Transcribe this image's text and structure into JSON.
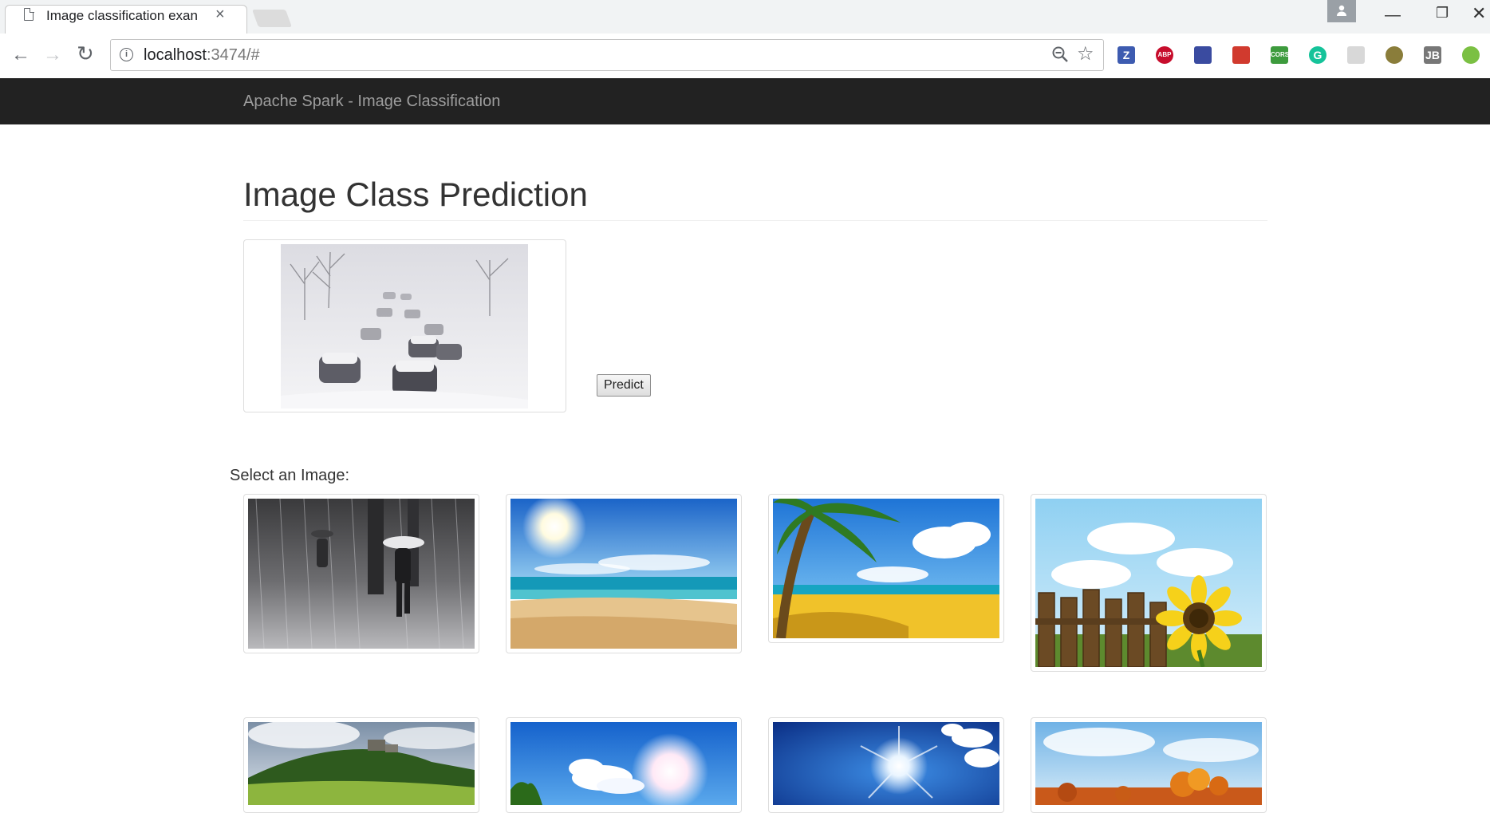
{
  "browser": {
    "tab_title": "Image classification exan",
    "tab_close": "×",
    "url_host": "localhost",
    "url_rest": ":3474/#",
    "info_glyph": "i",
    "star_glyph": "☆",
    "back_glyph": "←",
    "forward_glyph": "→",
    "reload_glyph": "↻",
    "min_glyph": "—",
    "restore_glyph": "❐",
    "close_glyph": "✕",
    "extensions": [
      {
        "name": "zotero-extension-icon",
        "label": "Z",
        "color": "#3d5bb0"
      },
      {
        "name": "adblock-plus-icon",
        "label": "ABP",
        "color": "#c70d2c"
      },
      {
        "name": "extension-flag-icon",
        "label": "",
        "color": "#3a4ba0"
      },
      {
        "name": "extension-book-icon",
        "label": "",
        "color": "#d13a2e"
      },
      {
        "name": "cors-extension-icon",
        "label": "CORS",
        "color": "#3d9b3d"
      },
      {
        "name": "grammarly-icon",
        "label": "G",
        "color": "#15c39a"
      },
      {
        "name": "extension-swirl-icon",
        "label": "",
        "color": "#d8d8d8"
      },
      {
        "name": "extension-shield-icon",
        "label": "",
        "color": "#8a7d3a"
      },
      {
        "name": "jetbrains-extension-icon",
        "label": "JB",
        "color": "#777777"
      },
      {
        "name": "extension-smiley-icon",
        "label": "",
        "color": "#7bc043"
      }
    ]
  },
  "navbar": {
    "brand": "Apache Spark - Image Classification"
  },
  "main": {
    "title": "Image Class Prediction",
    "predict_label": "Predict",
    "select_label": "Select an Image:",
    "preview": {
      "icon": "snowy-road-traffic-image"
    },
    "gallery": [
      {
        "icon": "rain-umbrella-image"
      },
      {
        "icon": "sunny-beach-image"
      },
      {
        "icon": "palm-beach-image"
      },
      {
        "icon": "sunflower-fence-image"
      },
      {
        "icon": "green-hill-castle-image"
      },
      {
        "icon": "sun-sky-clouds-image"
      },
      {
        "icon": "bright-sun-blue-sky-image"
      },
      {
        "icon": "autumn-trees-image"
      }
    ]
  }
}
